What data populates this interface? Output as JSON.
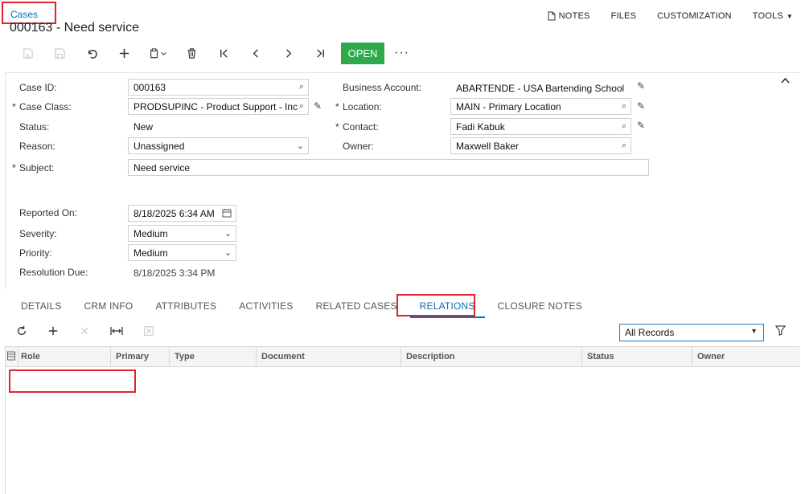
{
  "header": {
    "breadcrumb": "Cases",
    "title": "000163 - Need service",
    "links": {
      "notes": "NOTES",
      "files": "FILES",
      "customization": "CUSTOMIZATION",
      "tools": "TOOLS"
    }
  },
  "toolbar": {
    "open_label": "OPEN",
    "more_label": "···"
  },
  "form": {
    "case_id": {
      "label": "Case ID:",
      "value": "000163"
    },
    "case_class": {
      "label": "Case Class:",
      "value": "PRODSUPINC - Product Support - Inc"
    },
    "status": {
      "label": "Status:",
      "value": "New"
    },
    "reason": {
      "label": "Reason:",
      "value": "Unassigned"
    },
    "subject": {
      "label": "Subject:",
      "value": "Need service"
    },
    "business_account": {
      "label": "Business Account:",
      "value": "ABARTENDE - USA Bartending School"
    },
    "location": {
      "label": "Location:",
      "value": "MAIN - Primary Location"
    },
    "contact": {
      "label": "Contact:",
      "value": "Fadi Kabuk"
    },
    "owner": {
      "label": "Owner:",
      "value": "Maxwell Baker"
    },
    "reported_on": {
      "label": "Reported On:",
      "value": "8/18/2025 6:34 AM"
    },
    "severity": {
      "label": "Severity:",
      "value": "Medium"
    },
    "priority": {
      "label": "Priority:",
      "value": "Medium"
    },
    "resolution_due": {
      "label": "Resolution Due:",
      "value": "8/18/2025 3:34 PM"
    },
    "required_mark": "*"
  },
  "tabs": [
    "DETAILS",
    "CRM INFO",
    "ATTRIBUTES",
    "ACTIVITIES",
    "RELATED CASES",
    "RELATIONS",
    "CLOSURE NOTES"
  ],
  "active_tab": "RELATIONS",
  "grid": {
    "filter_value": "All Records",
    "columns": [
      "Role",
      "Primary",
      "Type",
      "Document",
      "Description",
      "Status",
      "Owner"
    ]
  },
  "colors": {
    "accent": "#0a6fb8",
    "open_button": "#2eaa4a",
    "highlight": "#e0232a"
  }
}
